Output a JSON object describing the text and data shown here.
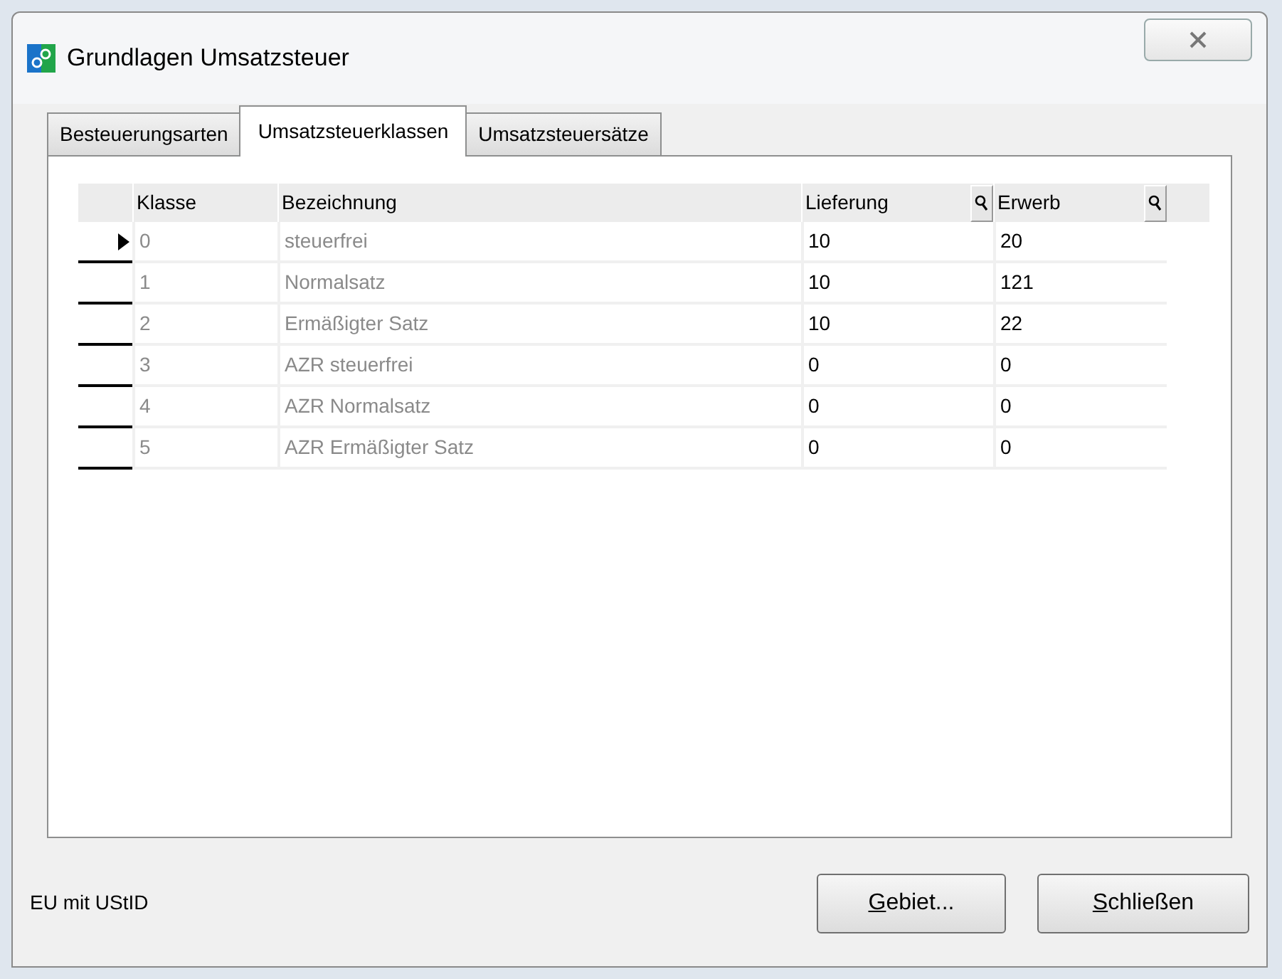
{
  "window": {
    "title": "Grundlagen Umsatzsteuer"
  },
  "tabs": [
    {
      "label": "Besteuerungsarten",
      "selected": false
    },
    {
      "label": "Umsatzsteuerklassen",
      "selected": true
    },
    {
      "label": "Umsatzsteuersätze",
      "selected": false
    }
  ],
  "table": {
    "columns": [
      {
        "label": "Klasse",
        "lookup": false
      },
      {
        "label": "Bezeichnung",
        "lookup": false
      },
      {
        "label": "Lieferung",
        "lookup": true
      },
      {
        "label": "Erwerb",
        "lookup": true
      }
    ],
    "rows": [
      {
        "current": true,
        "cells": [
          "0",
          "steuerfrei",
          "10",
          "20"
        ]
      },
      {
        "current": false,
        "cells": [
          "1",
          "Normalsatz",
          "10",
          "121"
        ]
      },
      {
        "current": false,
        "cells": [
          "2",
          "Ermäßigter Satz",
          "10",
          "22"
        ]
      },
      {
        "current": false,
        "cells": [
          "3",
          "AZR steuerfrei",
          "0",
          "0"
        ]
      },
      {
        "current": false,
        "cells": [
          "4",
          "AZR Normalsatz",
          "0",
          "0"
        ]
      },
      {
        "current": false,
        "cells": [
          "5",
          "AZR Ermäßigter Satz",
          "0",
          "0"
        ]
      }
    ]
  },
  "status_text": "EU mit UStID",
  "buttons": [
    {
      "mnemonic": "G",
      "rest": "ebiet..."
    },
    {
      "mnemonic": "S",
      "rest": "chließen"
    }
  ]
}
